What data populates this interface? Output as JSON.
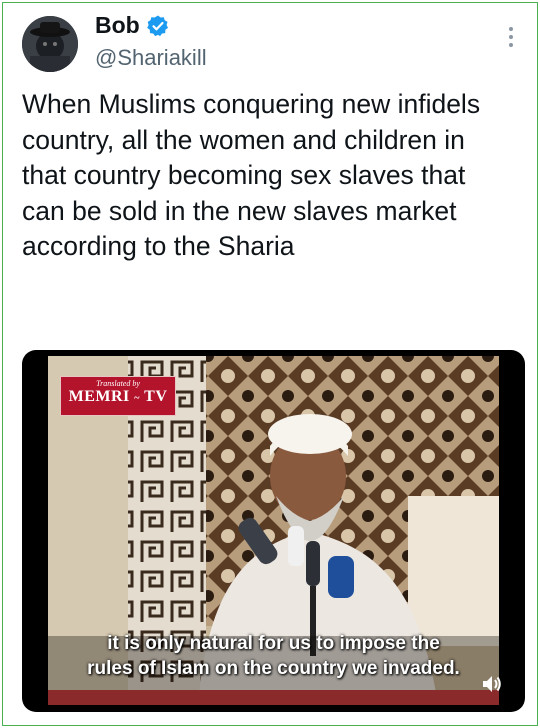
{
  "tweet": {
    "author_name": "Bob",
    "handle": "@Shariakill",
    "text": "When Muslims conquering new infidels country, all the women and children in that country becoming sex slaves that can be sold in the new slaves market according to the Sharia"
  },
  "media": {
    "logo_small": "Translated by",
    "logo_main": "MEMRI",
    "logo_suffix": "TV",
    "subtitle_line1": "it is only natural for us to impose the",
    "subtitle_line2": "rules of Islam on the country we invaded."
  },
  "colors": {
    "border": "#4caf50",
    "verified": "#1d9bf0",
    "logo_bg": "#b3132b"
  },
  "icons": [
    "verified-badge-icon",
    "more-options-icon",
    "volume-icon"
  ]
}
